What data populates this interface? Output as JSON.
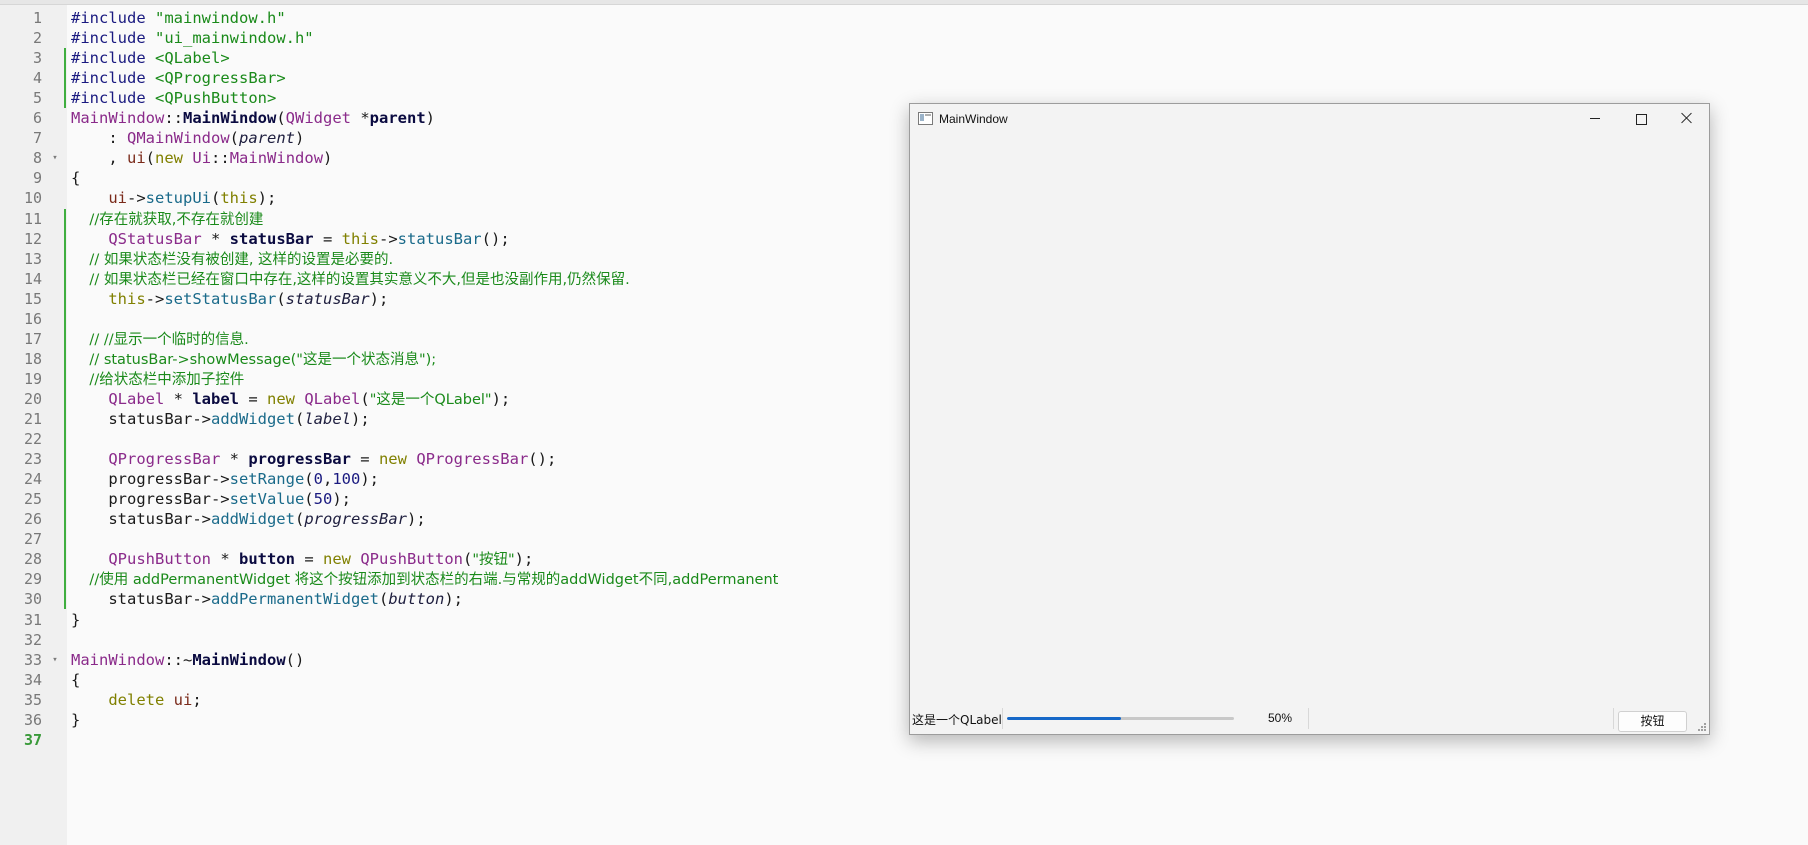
{
  "editor": {
    "lines": [
      {
        "n": "1",
        "mod": false,
        "fold": "",
        "segs": [
          {
            "t": "#include ",
            "c": "pp"
          },
          {
            "t": "\"mainwindow.h\"",
            "c": "str"
          }
        ]
      },
      {
        "n": "2",
        "mod": false,
        "fold": "",
        "segs": [
          {
            "t": "#include ",
            "c": "pp"
          },
          {
            "t": "\"ui_mainwindow.h\"",
            "c": "str"
          }
        ]
      },
      {
        "n": "3",
        "mod": true,
        "fold": "",
        "segs": [
          {
            "t": "#include ",
            "c": "pp"
          },
          {
            "t": "<QLabel>",
            "c": "str"
          }
        ]
      },
      {
        "n": "4",
        "mod": true,
        "fold": "",
        "segs": [
          {
            "t": "#include ",
            "c": "pp"
          },
          {
            "t": "<QProgressBar>",
            "c": "str"
          }
        ]
      },
      {
        "n": "5",
        "mod": true,
        "fold": "",
        "segs": [
          {
            "t": "#include ",
            "c": "pp"
          },
          {
            "t": "<QPushButton>",
            "c": "str"
          }
        ]
      },
      {
        "n": "6",
        "mod": false,
        "fold": "",
        "segs": [
          {
            "t": "MainWindow",
            "c": "cls"
          },
          {
            "t": "::",
            "c": ""
          },
          {
            "t": "MainWindow",
            "c": "fn bold"
          },
          {
            "t": "(",
            "c": ""
          },
          {
            "t": "QWidget",
            "c": "cls"
          },
          {
            "t": " *",
            "c": ""
          },
          {
            "t": "parent",
            "c": "bold"
          },
          {
            "t": ")",
            "c": ""
          }
        ]
      },
      {
        "n": "7",
        "mod": false,
        "fold": "",
        "segs": [
          {
            "t": "    : ",
            "c": ""
          },
          {
            "t": "QMainWindow",
            "c": "cls"
          },
          {
            "t": "(",
            "c": ""
          },
          {
            "t": "parent",
            "c": "it"
          },
          {
            "t": ")",
            "c": ""
          }
        ]
      },
      {
        "n": "8",
        "mod": false,
        "fold": "▾",
        "segs": [
          {
            "t": "    , ",
            "c": ""
          },
          {
            "t": "ui",
            "c": "member"
          },
          {
            "t": "(",
            "c": ""
          },
          {
            "t": "new",
            "c": "kw"
          },
          {
            "t": " ",
            "c": ""
          },
          {
            "t": "Ui",
            "c": "cls"
          },
          {
            "t": "::",
            "c": ""
          },
          {
            "t": "MainWindow",
            "c": "cls"
          },
          {
            "t": ")",
            "c": ""
          }
        ]
      },
      {
        "n": "9",
        "mod": false,
        "fold": "",
        "segs": [
          {
            "t": "{",
            "c": ""
          }
        ]
      },
      {
        "n": "10",
        "mod": false,
        "fold": "",
        "segs": [
          {
            "t": "    ",
            "c": ""
          },
          {
            "t": "ui",
            "c": "member"
          },
          {
            "t": "->",
            "c": ""
          },
          {
            "t": "setupUi",
            "c": "fn"
          },
          {
            "t": "(",
            "c": ""
          },
          {
            "t": "this",
            "c": "kw"
          },
          {
            "t": ");",
            "c": ""
          }
        ]
      },
      {
        "n": "11",
        "mod": true,
        "fold": "",
        "segs": [
          {
            "t": "    //存在就获取,不存在就创建",
            "c": "cm cn"
          }
        ]
      },
      {
        "n": "12",
        "mod": true,
        "fold": "",
        "segs": [
          {
            "t": "    ",
            "c": ""
          },
          {
            "t": "QStatusBar",
            "c": "cls"
          },
          {
            "t": " * ",
            "c": ""
          },
          {
            "t": "statusBar",
            "c": "bold"
          },
          {
            "t": " = ",
            "c": ""
          },
          {
            "t": "this",
            "c": "kw"
          },
          {
            "t": "->",
            "c": ""
          },
          {
            "t": "statusBar",
            "c": "fn"
          },
          {
            "t": "();",
            "c": ""
          }
        ]
      },
      {
        "n": "13",
        "mod": true,
        "fold": "",
        "segs": [
          {
            "t": "    // 如果状态栏没有被创建, 这样的设置是必要的.",
            "c": "cm cn"
          }
        ]
      },
      {
        "n": "14",
        "mod": true,
        "fold": "",
        "segs": [
          {
            "t": "    // 如果状态栏已经在窗口中存在,这样的设置其实意义不大,但是也没副作用,仍然保留.",
            "c": "cm cn"
          }
        ]
      },
      {
        "n": "15",
        "mod": true,
        "fold": "",
        "segs": [
          {
            "t": "    ",
            "c": ""
          },
          {
            "t": "this",
            "c": "kw"
          },
          {
            "t": "->",
            "c": ""
          },
          {
            "t": "setStatusBar",
            "c": "fn"
          },
          {
            "t": "(",
            "c": ""
          },
          {
            "t": "statusBar",
            "c": "it"
          },
          {
            "t": ");",
            "c": ""
          }
        ]
      },
      {
        "n": "16",
        "mod": true,
        "fold": "",
        "segs": []
      },
      {
        "n": "17",
        "mod": true,
        "fold": "",
        "segs": [
          {
            "t": "    // //显示一个临时的信息.",
            "c": "cm cn"
          }
        ]
      },
      {
        "n": "18",
        "mod": true,
        "fold": "",
        "segs": [
          {
            "t": "    // statusBar->showMessage(\"这是一个状态消息\");",
            "c": "cm cn"
          }
        ]
      },
      {
        "n": "19",
        "mod": true,
        "fold": "",
        "segs": [
          {
            "t": "    //给状态栏中添加子控件",
            "c": "cm cn"
          }
        ]
      },
      {
        "n": "20",
        "mod": true,
        "fold": "",
        "segs": [
          {
            "t": "    ",
            "c": ""
          },
          {
            "t": "QLabel",
            "c": "cls"
          },
          {
            "t": " * ",
            "c": ""
          },
          {
            "t": "label",
            "c": "bold"
          },
          {
            "t": " = ",
            "c": ""
          },
          {
            "t": "new",
            "c": "kw"
          },
          {
            "t": " ",
            "c": ""
          },
          {
            "t": "QLabel",
            "c": "cls"
          },
          {
            "t": "(",
            "c": ""
          },
          {
            "t": "\"这是一个QLabel\"",
            "c": "str cn"
          },
          {
            "t": ");",
            "c": ""
          }
        ]
      },
      {
        "n": "21",
        "mod": true,
        "fold": "",
        "segs": [
          {
            "t": "    statusBar->",
            "c": ""
          },
          {
            "t": "addWidget",
            "c": "fn"
          },
          {
            "t": "(",
            "c": ""
          },
          {
            "t": "label",
            "c": "it"
          },
          {
            "t": ");",
            "c": ""
          }
        ]
      },
      {
        "n": "22",
        "mod": true,
        "fold": "",
        "segs": []
      },
      {
        "n": "23",
        "mod": true,
        "fold": "",
        "segs": [
          {
            "t": "    ",
            "c": ""
          },
          {
            "t": "QProgressBar",
            "c": "cls"
          },
          {
            "t": " * ",
            "c": ""
          },
          {
            "t": "progressBar",
            "c": "bold"
          },
          {
            "t": " = ",
            "c": ""
          },
          {
            "t": "new",
            "c": "kw"
          },
          {
            "t": " ",
            "c": ""
          },
          {
            "t": "QProgressBar",
            "c": "cls"
          },
          {
            "t": "();",
            "c": ""
          }
        ]
      },
      {
        "n": "24",
        "mod": true,
        "fold": "",
        "segs": [
          {
            "t": "    progressBar->",
            "c": ""
          },
          {
            "t": "setRange",
            "c": "fn"
          },
          {
            "t": "(",
            "c": ""
          },
          {
            "t": "0",
            "c": "num"
          },
          {
            "t": ",",
            "c": ""
          },
          {
            "t": "100",
            "c": "num"
          },
          {
            "t": ");",
            "c": ""
          }
        ]
      },
      {
        "n": "25",
        "mod": true,
        "fold": "",
        "segs": [
          {
            "t": "    progressBar->",
            "c": ""
          },
          {
            "t": "setValue",
            "c": "fn"
          },
          {
            "t": "(",
            "c": ""
          },
          {
            "t": "50",
            "c": "num"
          },
          {
            "t": ");",
            "c": ""
          }
        ]
      },
      {
        "n": "26",
        "mod": true,
        "fold": "",
        "segs": [
          {
            "t": "    statusBar->",
            "c": ""
          },
          {
            "t": "addWidget",
            "c": "fn"
          },
          {
            "t": "(",
            "c": ""
          },
          {
            "t": "progressBar",
            "c": "it"
          },
          {
            "t": ");",
            "c": ""
          }
        ]
      },
      {
        "n": "27",
        "mod": true,
        "fold": "",
        "segs": []
      },
      {
        "n": "28",
        "mod": true,
        "fold": "",
        "segs": [
          {
            "t": "    ",
            "c": ""
          },
          {
            "t": "QPushButton",
            "c": "cls"
          },
          {
            "t": " * ",
            "c": ""
          },
          {
            "t": "button",
            "c": "bold"
          },
          {
            "t": " = ",
            "c": ""
          },
          {
            "t": "new",
            "c": "kw"
          },
          {
            "t": " ",
            "c": ""
          },
          {
            "t": "QPushButton",
            "c": "cls"
          },
          {
            "t": "(",
            "c": ""
          },
          {
            "t": "\"按钮\"",
            "c": "str cn"
          },
          {
            "t": ");",
            "c": ""
          }
        ]
      },
      {
        "n": "29",
        "mod": true,
        "fold": "",
        "segs": [
          {
            "t": "    //使用 addPermanentWidget 将这个按钮添加到状态栏的右端.与常规的addWidget不同,addPermanent",
            "c": "cm cn"
          }
        ]
      },
      {
        "n": "30",
        "mod": true,
        "fold": "",
        "segs": [
          {
            "t": "    statusBar->",
            "c": ""
          },
          {
            "t": "addPermanentWidget",
            "c": "fn"
          },
          {
            "t": "(",
            "c": ""
          },
          {
            "t": "button",
            "c": "it"
          },
          {
            "t": ");",
            "c": ""
          }
        ]
      },
      {
        "n": "31",
        "mod": false,
        "fold": "",
        "segs": [
          {
            "t": "}",
            "c": ""
          }
        ]
      },
      {
        "n": "32",
        "mod": false,
        "fold": "",
        "segs": []
      },
      {
        "n": "33",
        "mod": false,
        "fold": "▾",
        "segs": [
          {
            "t": "MainWindow",
            "c": "cls"
          },
          {
            "t": "::~",
            "c": ""
          },
          {
            "t": "MainWindow",
            "c": "fn bold"
          },
          {
            "t": "()",
            "c": ""
          }
        ]
      },
      {
        "n": "34",
        "mod": false,
        "fold": "",
        "segs": [
          {
            "t": "{",
            "c": ""
          }
        ]
      },
      {
        "n": "35",
        "mod": false,
        "fold": "",
        "segs": [
          {
            "t": "    ",
            "c": ""
          },
          {
            "t": "delete",
            "c": "kw"
          },
          {
            "t": " ",
            "c": ""
          },
          {
            "t": "ui",
            "c": "member"
          },
          {
            "t": ";",
            "c": ""
          }
        ]
      },
      {
        "n": "36",
        "mod": false,
        "fold": "",
        "segs": [
          {
            "t": "}",
            "c": ""
          }
        ]
      },
      {
        "n": "37",
        "mod": false,
        "fold": "",
        "current": true,
        "segs": []
      }
    ]
  },
  "window": {
    "title": "MainWindow",
    "icon": "app-window-icon",
    "controls": {
      "minimize": "minimize-icon",
      "maximize": "maximize-icon",
      "close": "close-icon"
    },
    "statusbar": {
      "label": "这是一个QLabel",
      "progress": {
        "min": 0,
        "max": 100,
        "value": 50,
        "text": "50%"
      },
      "button_label": "按钮"
    }
  },
  "colors": {
    "progress_fill": "#1668c8",
    "modified_marker": "#3fae3f"
  }
}
